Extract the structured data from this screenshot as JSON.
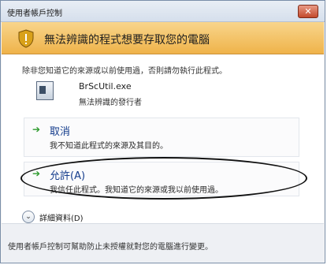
{
  "window": {
    "title": "使用者帳戶控制",
    "close_label": "✕"
  },
  "banner": {
    "text": "無法辨識的程式想要存取您的電腦"
  },
  "content": {
    "warning": "除非您知道它的來源或以前使用過，否則請勿執行此程式。",
    "program": {
      "name": "BrScUtil.exe",
      "publisher": "無法辨識的發行者"
    }
  },
  "options": {
    "cancel": {
      "label": "取消",
      "description": "我不知道此程式的來源及其目的。"
    },
    "allow": {
      "label": "允許(A)",
      "description": "我信任此程式。我知道它的來源或我以前使用過。"
    }
  },
  "details": {
    "label": "詳細資料(D)"
  },
  "footer": {
    "text": "使用者帳戶控制可幫助防止未授權就對您的電腦進行變更。"
  },
  "colors": {
    "banner": "#efb34a",
    "link": "#143c8c",
    "arrow": "#2e9b2e",
    "close": "#c34a2c"
  }
}
